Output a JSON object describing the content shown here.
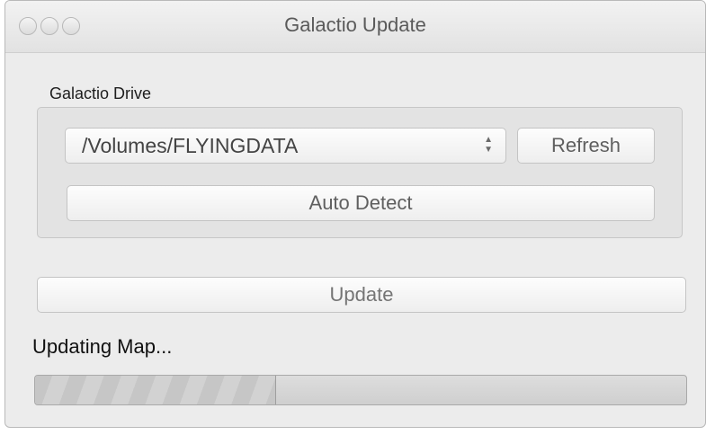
{
  "window": {
    "title": "Galactio Update"
  },
  "drive_group": {
    "label": "Galactio Drive",
    "selected_volume": "/Volumes/FLYINGDATA",
    "select_icon": "updown-chevron-icon",
    "refresh_label": "Refresh",
    "auto_detect_label": "Auto Detect"
  },
  "update_label": "Update",
  "status_text": "Updating Map...",
  "progress": {
    "value_fraction": 0.37
  },
  "colors": {
    "window_background": "#ececec",
    "group_background": "#e3e3e3",
    "button_text": "#5f5f5f",
    "disabled_text": "#757575"
  }
}
